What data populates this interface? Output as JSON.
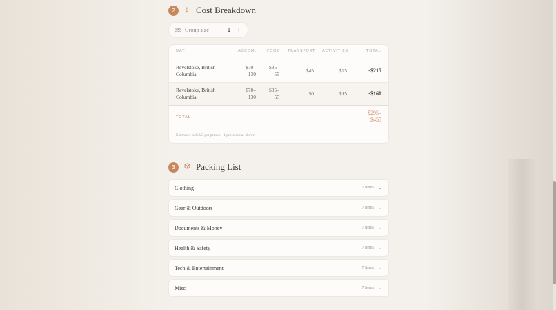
{
  "cost_section": {
    "number": "2",
    "icon": "dollar-icon",
    "title": "Cost Breakdown"
  },
  "group_size": {
    "icon": "people-icon",
    "label": "Group size",
    "minus": "-",
    "value": "1",
    "plus": "+"
  },
  "cost_table": {
    "headers": [
      "DAY",
      "ACCOM.",
      "FOOD",
      "TRANSPORT",
      "ACTIVITIES",
      "TOTAL"
    ],
    "rows": [
      {
        "day_line1": "Revelstoke, British",
        "day_line2": "Columbia",
        "accom_line1": "$70–",
        "accom_line2": "130",
        "food_line1": "$35–",
        "food_line2": "55",
        "transport": "$45",
        "activities": "$25",
        "total": "~$215"
      },
      {
        "day_line1": "Revelstoke, British",
        "day_line2": "Columbia",
        "accom_line1": "$70–",
        "accom_line2": "130",
        "food_line1": "$35–",
        "food_line2": "55",
        "transport": "$0",
        "activities": "$15",
        "total": "~$160"
      }
    ],
    "total_label": "TOTAL",
    "total_line1": "$295–",
    "total_line2": "$455",
    "note": "Estimates in CAD per person · 1 person total shown"
  },
  "packing_section": {
    "number": "3",
    "icon": "box-icon",
    "title": "Packing List"
  },
  "packing_items": [
    {
      "label": "Clothing",
      "count": "7 items"
    },
    {
      "label": "Gear & Outdoors",
      "count": "7 items"
    },
    {
      "label": "Documents & Money",
      "count": "7 items"
    },
    {
      "label": "Health & Safety",
      "count": "7 items"
    },
    {
      "label": "Tech & Entertainment",
      "count": "7 items"
    },
    {
      "label": "Misc",
      "count": "7 items"
    }
  ],
  "colors": {
    "accent": "#c9875e",
    "background": "#f4f1ec",
    "card": "#fdfcfb"
  }
}
